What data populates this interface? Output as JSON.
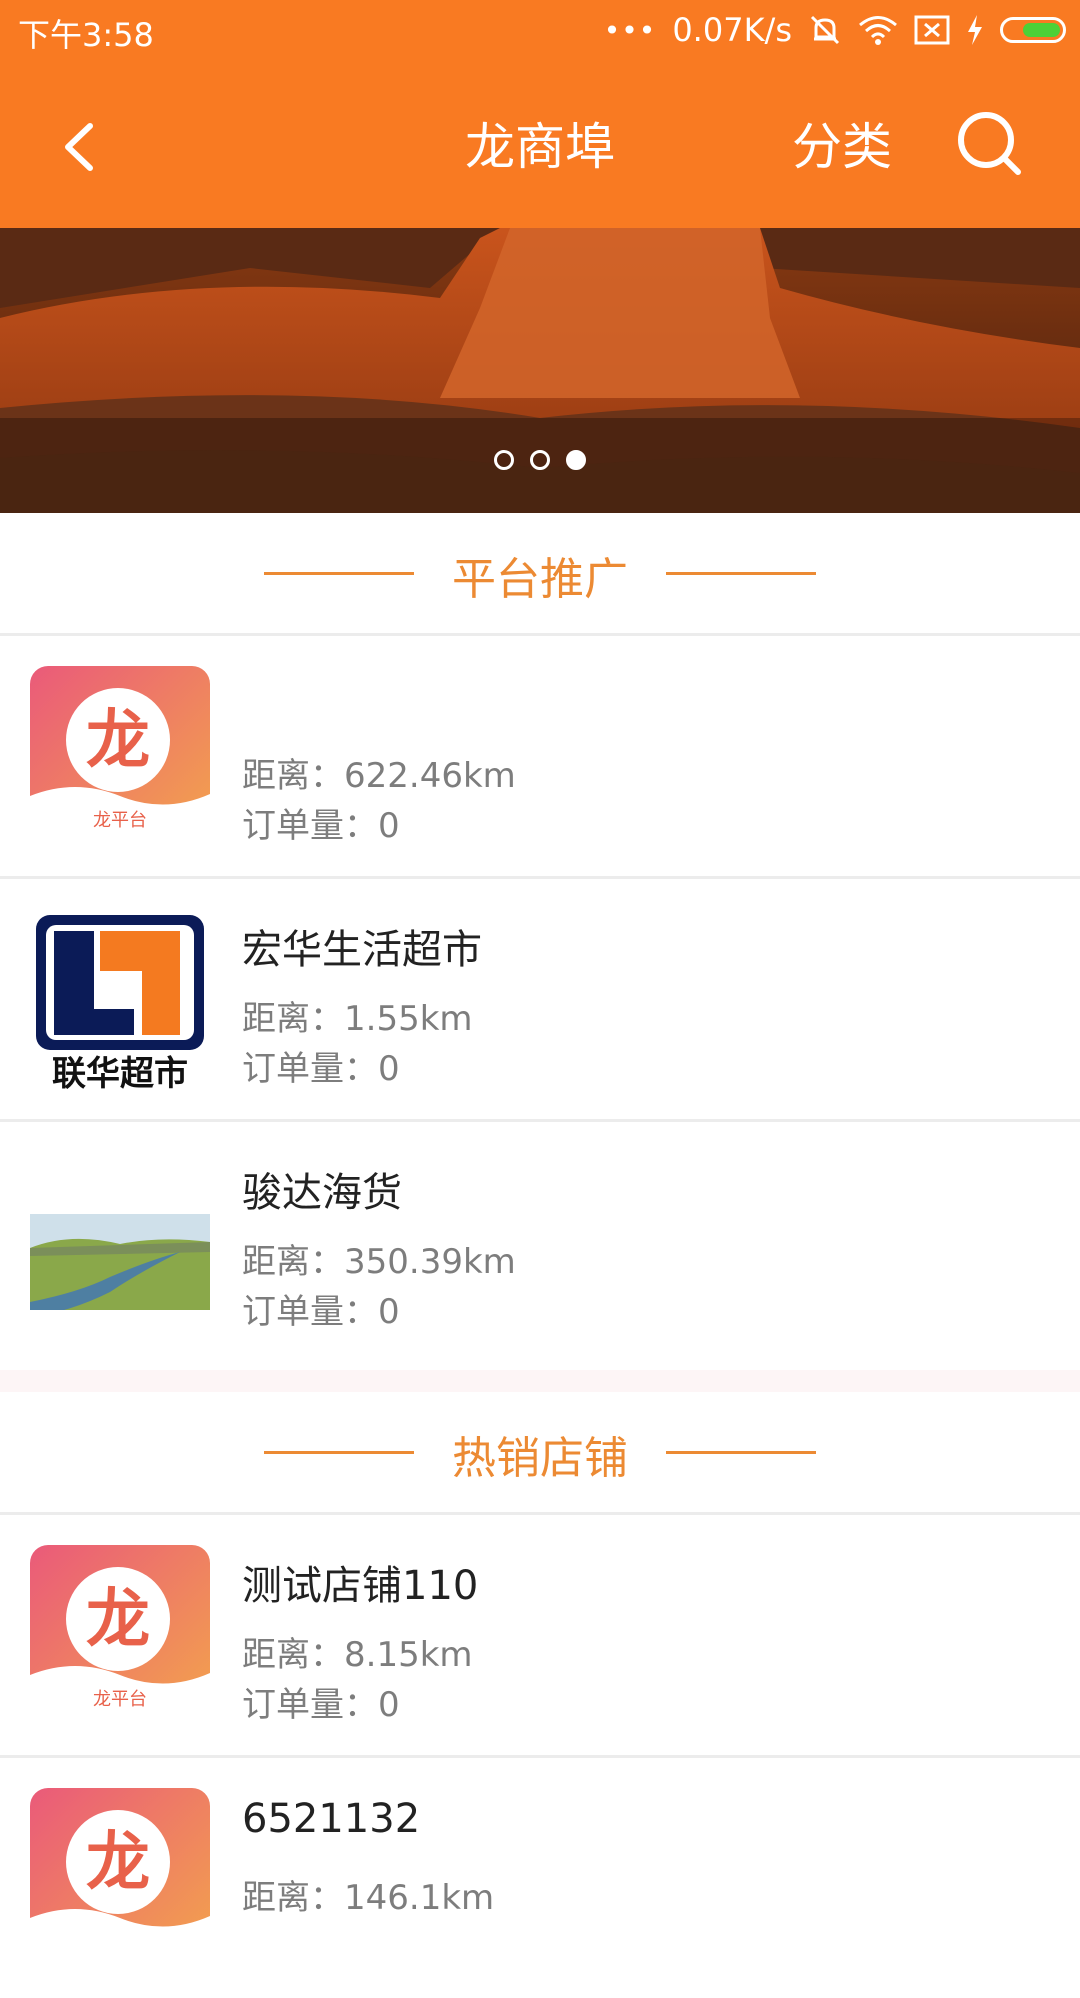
{
  "status": {
    "time": "下午3:58",
    "net_speed": "0.07K/s",
    "signal_dots": "•••"
  },
  "appbar": {
    "title": "龙商埠",
    "category_label": "分类"
  },
  "sections": {
    "promo_title": "平台推广",
    "hot_title": "热销店铺"
  },
  "logo_text": {
    "dragon_char": "龙",
    "dragon_sub": "龙平台",
    "lianhua": "联华超市"
  },
  "promo_items": [
    {
      "name": "",
      "distance": "距离：622.46km",
      "orders": "订单量：0",
      "thumb": "dragon-logo"
    },
    {
      "name": "宏华生活超市",
      "distance": "距离：1.55km",
      "orders": "订单量：0",
      "thumb": "lianhua-logo"
    },
    {
      "name": "骏达海货",
      "distance": "距离：350.39km",
      "orders": "订单量：0",
      "thumb": "river-photo"
    }
  ],
  "hot_items": [
    {
      "name": "测试店铺110",
      "distance": "距离：8.15km",
      "orders": "订单量：0",
      "thumb": "dragon-logo"
    },
    {
      "name": "6521132",
      "distance": "距离：146.1km",
      "orders": "",
      "thumb": "dragon-logo"
    }
  ],
  "colors": {
    "brand_orange": "#f97a22",
    "section_orange": "#ec8a33",
    "meta_gray": "#7d7d7d"
  },
  "icons": [
    "back-arrow-icon",
    "search-icon",
    "wifi-icon",
    "mute-icon",
    "sim-icon",
    "charging-icon",
    "battery-icon"
  ]
}
